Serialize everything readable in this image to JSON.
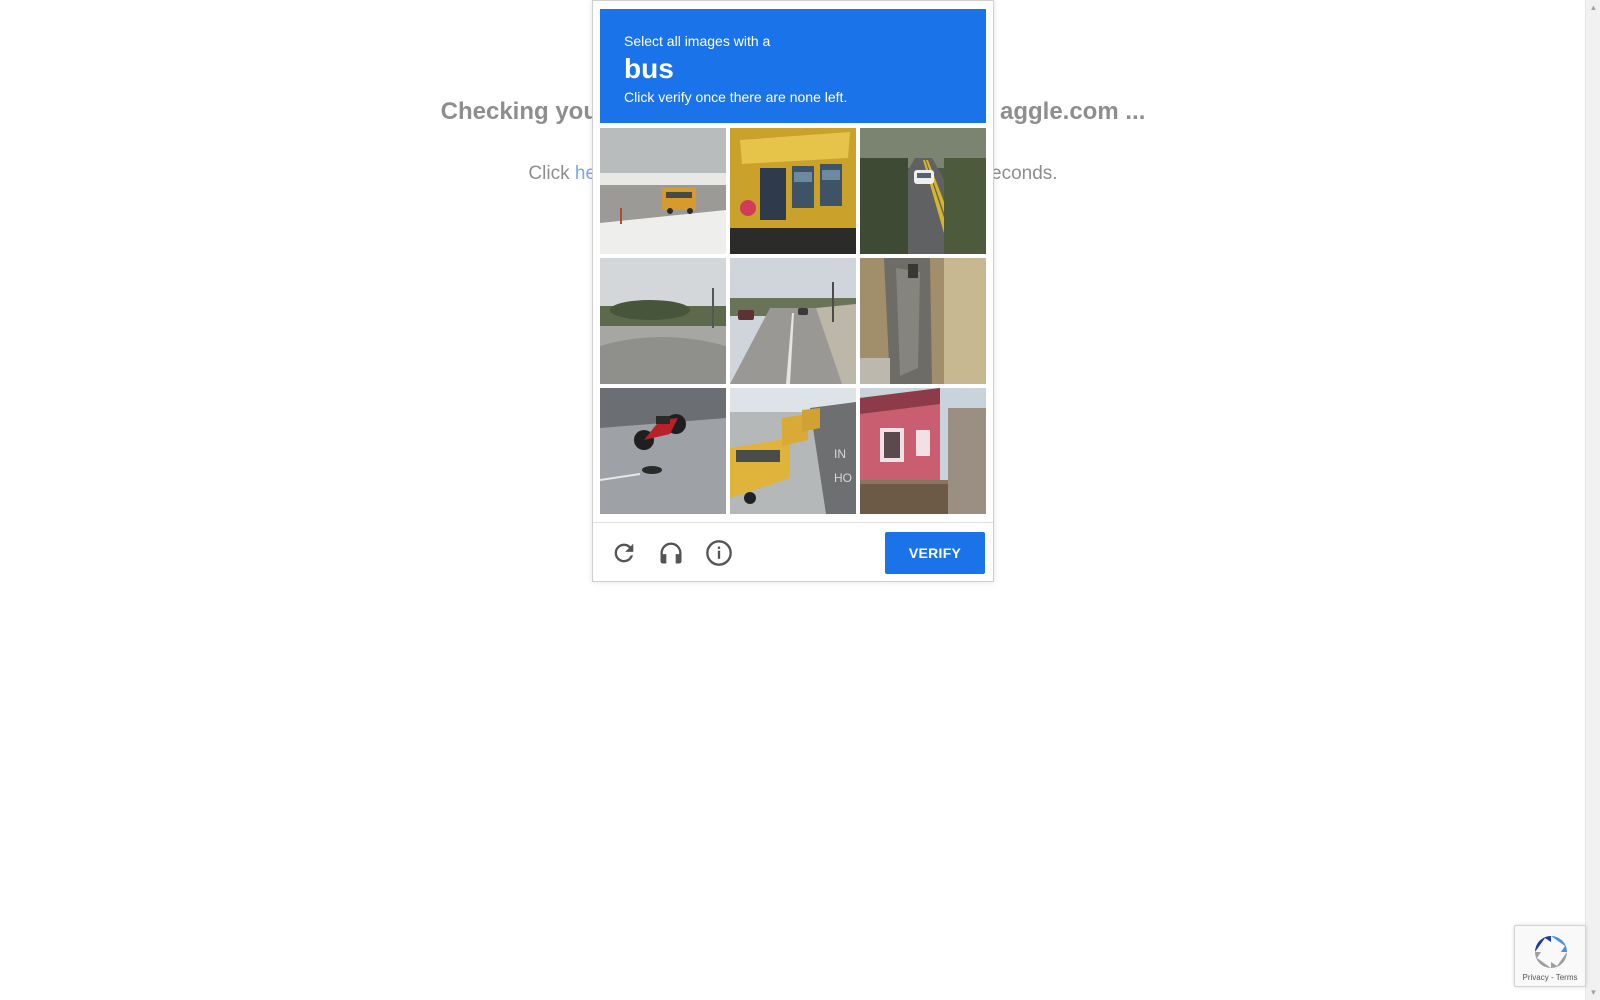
{
  "background": {
    "heading_left": "Checking you",
    "heading_right": "aggle.com ...",
    "sub_prefix": "Click ",
    "sub_link": "he",
    "sub_suffix": "econds."
  },
  "challenge": {
    "instruction": "Select all images with a",
    "target_object": "bus",
    "hint": "Click verify once there are none left.",
    "tiles": [
      {
        "subject": "school bus on highway"
      },
      {
        "subject": "close-up of yellow school bus"
      },
      {
        "subject": "car on tree-lined road"
      },
      {
        "subject": "empty road with trees"
      },
      {
        "subject": "suburban street with cars"
      },
      {
        "subject": "tree trunk"
      },
      {
        "subject": "red motorcycle on street"
      },
      {
        "subject": "row of parked school buses"
      },
      {
        "subject": "pink house"
      }
    ],
    "verify_label": "VERIFY",
    "colors": {
      "accent": "#1a73e8"
    }
  },
  "footer_icons": [
    "reload-icon",
    "headphones-icon",
    "info-icon"
  ],
  "badge": {
    "links": "Privacy - Terms"
  }
}
